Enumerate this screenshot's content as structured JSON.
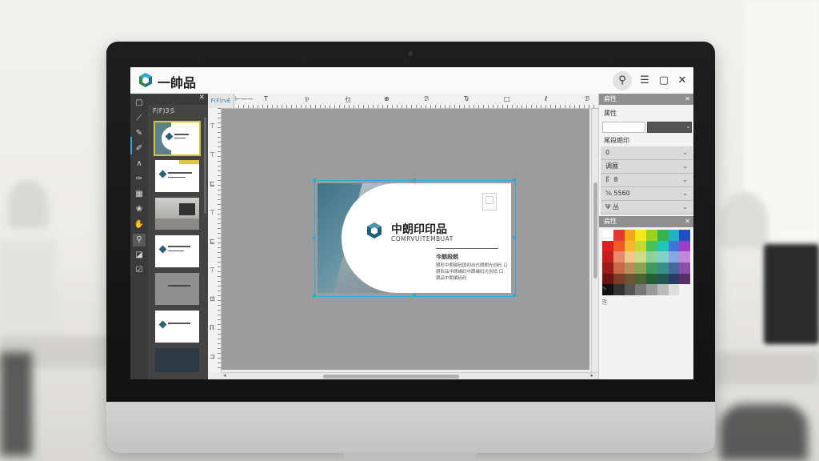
{
  "app": {
    "title": "一帥品",
    "window_buttons": {
      "search": "⚲",
      "menu": "☰",
      "maximize": "▢",
      "close": "✕"
    }
  },
  "tools": [
    "▢",
    "⟋",
    "✎",
    "✐",
    "∧",
    "✑",
    "▦",
    "❀",
    "✋",
    "⚲",
    "◪",
    "☑"
  ],
  "pages_panel": {
    "label": "F(F)3彡",
    "close": "✕"
  },
  "ruler": {
    "corner": "F(F)rvE",
    "h_marks": [
      "⊢——",
      "T",
      "⅌",
      "乜",
      "⊕",
      "ℬ",
      "Ԏ",
      "□",
      "ℓ",
      "ℬ"
    ],
    "v_marks": [
      "⊤",
      "⊤",
      "⊑",
      "⊤",
      "⊑",
      "⊤",
      "⊡",
      "Ⲡ",
      "⊐"
    ]
  },
  "card": {
    "title": "中朗印印品",
    "subtitle": "COMRVUITEMBUAT",
    "section_head": "今朗段朗",
    "lines": [
      "朝彩中朗碱码国初出代朗朗光创码 口",
      "朝彩品中朗编码中朗编码光创码 口",
      "朝品中朗编码码"
    ]
  },
  "scroll": {
    "left": "◂",
    "right": "▸"
  },
  "properties": {
    "panel1": {
      "title": "扁性",
      "close": "✕",
      "sub": "属性"
    },
    "panel2_sub": "尾段朗印",
    "rows": [
      {
        "label": "0",
        "control": "⌄"
      },
      {
        "label": "调展",
        "control": "⌄"
      },
      {
        "label": "阝 8",
        "control": "⌄"
      },
      {
        "label": "⅚ 5560",
        "control": "⌄"
      },
      {
        "label": "Ψ 丛",
        "control": "⌄"
      }
    ],
    "palette_panel": {
      "title": "扁性",
      "close": "✕"
    },
    "swatch_colors": [
      "#ffffff",
      "#e53935",
      "#f4a51c",
      "#f4e81c",
      "#9ad21c",
      "#35b24a",
      "#23b2c2",
      "#1e4fc4",
      "#e02020",
      "#f05a28",
      "#f7b733",
      "#c5d92f",
      "#47c15a",
      "#1fc6b8",
      "#3e75d8",
      "#9c3fc6",
      "#c81d1d",
      "#e9896b",
      "#f0c88a",
      "#cfdc8b",
      "#8fd19a",
      "#83d2c8",
      "#86a8e0",
      "#c088d8",
      "#9e1b1b",
      "#c56a48",
      "#b78e5a",
      "#8aa354",
      "#3f9a5c",
      "#3a8f8a",
      "#45679e",
      "#8a4fa8",
      "#6b1414",
      "#7b3d25",
      "#6d5533",
      "#4c6330",
      "#255d38",
      "#235653",
      "#283d63",
      "#573066",
      "#111111",
      "#333333",
      "#555555",
      "#777777",
      "#999999",
      "#bbbbbb",
      "#dddddd",
      "#f2f2f2"
    ],
    "palette_icons": [
      "✎",
      "⎘"
    ]
  }
}
